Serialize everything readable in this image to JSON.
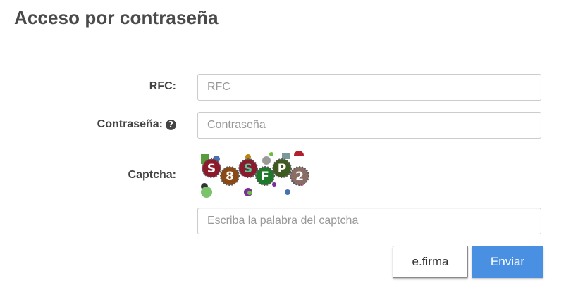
{
  "page": {
    "title": "Acceso por contraseña"
  },
  "form": {
    "rfc": {
      "label": "RFC:",
      "value": "",
      "placeholder": "RFC"
    },
    "password": {
      "label": "Contraseña:",
      "help_icon": "question-circle-icon",
      "value": "",
      "placeholder": "Contraseña"
    },
    "captcha": {
      "label": "Captcha:",
      "image_text": "S8SFP2",
      "value": "",
      "placeholder": "Escriba la palabra del captcha"
    }
  },
  "buttons": {
    "efirma_label": "e.firma",
    "submit_label": "Enviar"
  },
  "colors": {
    "title": "#4a4a4a",
    "submit_bg": "#4a90e2",
    "border": "#cccccc"
  }
}
